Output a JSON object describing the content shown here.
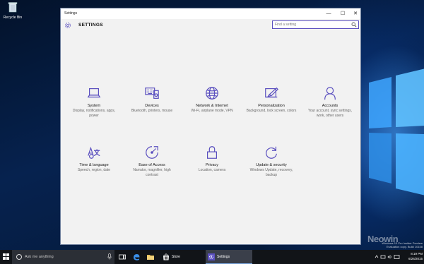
{
  "desktop": {
    "recycle_bin_label": "Recycle Bin",
    "branding": "Neowin",
    "build_line1": "Windows 10 Pro Insider Preview",
    "build_line2": "Evaluation copy. Build 10158"
  },
  "window": {
    "title": "Settings",
    "header_title": "SETTINGS",
    "controls": {
      "minimize": "—",
      "maximize": "☐",
      "close": "✕"
    },
    "search_placeholder": "Find a setting"
  },
  "tiles": [
    {
      "icon": "laptop-icon",
      "name": "System",
      "desc": "Display, notifications, apps, power"
    },
    {
      "icon": "keyboard-icon",
      "name": "Devices",
      "desc": "Bluetooth, printers, mouse"
    },
    {
      "icon": "globe-icon",
      "name": "Network & Internet",
      "desc": "Wi-Fi, airplane mode, VPN"
    },
    {
      "icon": "paintbrush-icon",
      "name": "Personalization",
      "desc": "Background, lock screen, colors"
    },
    {
      "icon": "person-icon",
      "name": "Accounts",
      "desc": "Your account, sync settings, work, other users"
    },
    {
      "icon": "language-icon",
      "name": "Time & language",
      "desc": "Speech, region, date"
    },
    {
      "icon": "ease-of-access-icon",
      "name": "Ease of Access",
      "desc": "Narrator, magnifier, high contrast"
    },
    {
      "icon": "lock-icon",
      "name": "Privacy",
      "desc": "Location, camera"
    },
    {
      "icon": "sync-icon",
      "name": "Update & security",
      "desc": "Windows Update, recovery, backup"
    }
  ],
  "taskbar": {
    "search_placeholder": "Ask me anything",
    "apps": [
      {
        "label": "Store"
      },
      {
        "label": "Settings"
      }
    ],
    "time": "8:19 PM",
    "date": "6/26/2015"
  },
  "colors": {
    "accent": "#5a4fbf",
    "taskbar": "#111418",
    "window_bg": "#f2f2f2"
  }
}
